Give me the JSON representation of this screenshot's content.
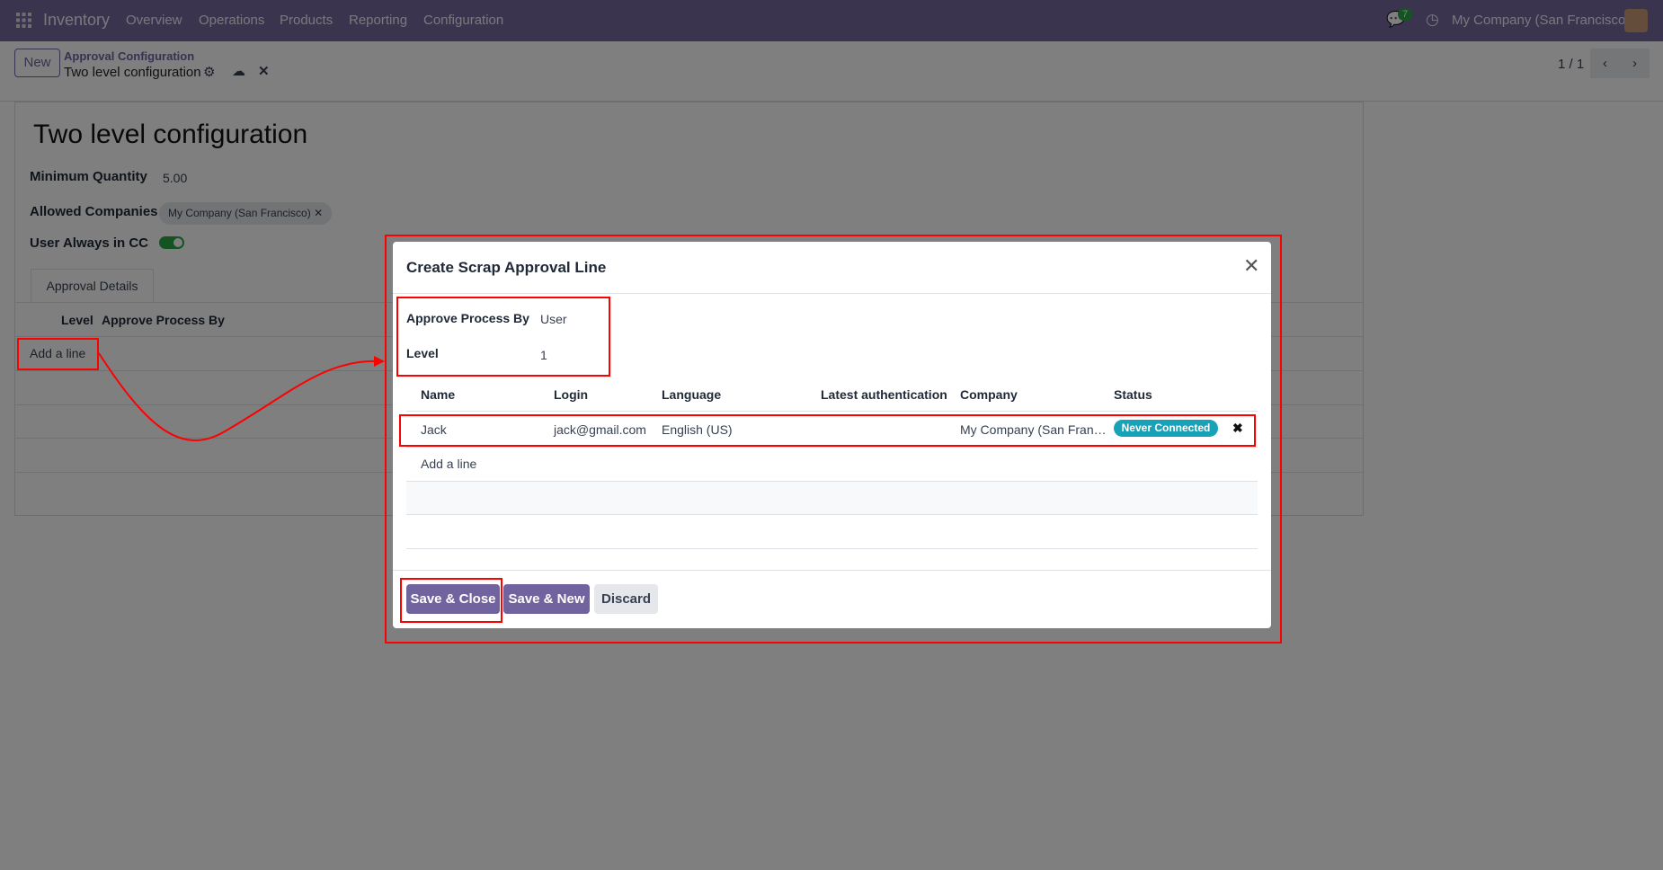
{
  "navbar": {
    "app": "Inventory",
    "menu": [
      "Overview",
      "Operations",
      "Products",
      "Reporting",
      "Configuration"
    ],
    "messages_count": "7",
    "company": "My Company (San Francisco)"
  },
  "control_panel": {
    "new_label": "New",
    "breadcrumb_parent": "Approval Configuration",
    "breadcrumb_current": "Two level configuration",
    "pager": "1 / 1"
  },
  "form": {
    "title": "Two level configuration",
    "fields": {
      "min_qty_label": "Minimum Quantity",
      "min_qty_value": "5.00",
      "companies_label": "Allowed Companies",
      "company_tag": "My Company (San Francisco)",
      "cc_label": "User Always in CC",
      "cc_value": true
    },
    "tab": "Approval Details",
    "list_headers": [
      "Level",
      "Approve Process By"
    ],
    "add_line": "Add a line"
  },
  "dialog": {
    "title": "Create Scrap Approval Line",
    "approve_label": "Approve Process By",
    "approve_value": "User",
    "level_label": "Level",
    "level_value": "1",
    "headers": [
      "Name",
      "Login",
      "Language",
      "Latest authentication",
      "Company",
      "Status"
    ],
    "rows": [
      {
        "name": "Jack",
        "login": "jack@gmail.com",
        "language": "English (US)",
        "latest_auth": "",
        "company": "My Company (San Fran…",
        "status": "Never Connected"
      }
    ],
    "add_line": "Add a line",
    "buttons": {
      "save_close": "Save & Close",
      "save_new": "Save & New",
      "discard": "Discard"
    }
  },
  "colors": {
    "brand": "#71639e",
    "badge": "#17a2b8",
    "toggle": "#28a745",
    "annotation": "#ff0000"
  }
}
